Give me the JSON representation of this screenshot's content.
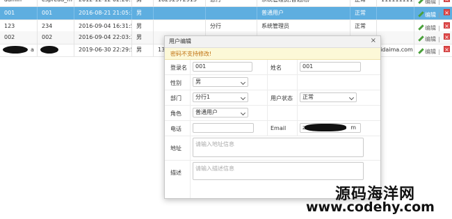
{
  "table": {
    "rows": [
      {
        "state": "normal",
        "cells": [
          "admin",
          "espread_m",
          "2012-12-12 02:20:10",
          "男",
          "18292972913",
          "总行",
          "系统管理员,普通用户",
          "正常",
          "11111111111"
        ]
      },
      {
        "state": "selected",
        "cells": [
          "001",
          "001",
          "2016-08-21 21:05:31",
          "男",
          "",
          "",
          "普通用户",
          "正常",
          ""
        ]
      },
      {
        "state": "normal",
        "cells": [
          "123",
          "234",
          "2016-09-04 16:31:51",
          "男",
          "",
          "分行",
          "系统管理员",
          "正常",
          ""
        ]
      },
      {
        "state": "even",
        "cells": [
          "002",
          "002",
          "2016-09-04 22:03:36",
          "男",
          "",
          "",
          "",
          "",
          ""
        ]
      },
      {
        "state": "normal",
        "cells": [
          "a",
          "",
          "2019-06-30 22:29:56",
          "男",
          "135",
          "",
          "",
          "",
          "uidaima.com"
        ]
      }
    ],
    "edit_label": "编辑",
    "delete_label": "×",
    "separator": "|"
  },
  "dialog": {
    "title": "用户编辑",
    "close_symbol": "×",
    "warning": "密码不支持修改!",
    "fields": {
      "login_label": "登录名",
      "login_value": "001",
      "name_label": "姓名",
      "name_value": "001",
      "gender_label": "性别",
      "gender_value": "男",
      "dept_label": "部门",
      "dept_value": "分行1",
      "status_label": "用户状态",
      "status_value": "正常",
      "role_label": "角色",
      "role_value": "普通用户",
      "phone_label": "电话",
      "phone_value": "",
      "email_label": "Email",
      "email_value": "z",
      "email_tail": "m",
      "address_label": "地址",
      "address_placeholder": "请输入地址信息",
      "desc_label": "描述",
      "desc_placeholder": "请输入描述信息"
    }
  },
  "watermark": {
    "line1": "源码海洋网",
    "line2": "www.codehy.com"
  },
  "colors": {
    "selected_row": "#5eaee0",
    "warning_bg": "#fcf8d7",
    "warning_text": "#c07010",
    "delete_red": "#e04a4a",
    "edit_green": "#4aa03a"
  }
}
